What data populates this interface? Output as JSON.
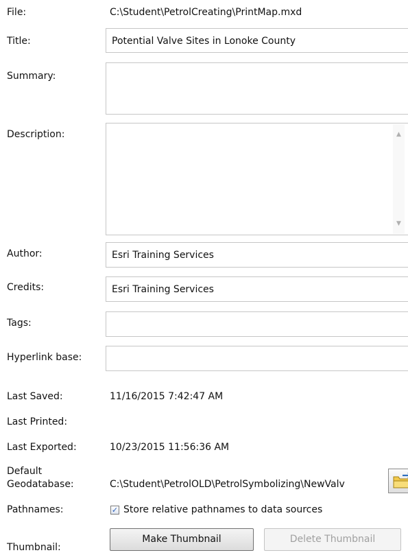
{
  "labels": {
    "file": "File:",
    "title": "Title:",
    "summary": "Summary:",
    "description": "Description:",
    "author": "Author:",
    "credits": "Credits:",
    "tags": "Tags:",
    "hyperlink_base": "Hyperlink base:",
    "last_saved": "Last Saved:",
    "last_printed": "Last Printed:",
    "last_exported": "Last Exported:",
    "default_geodatabase_line1": "Default",
    "default_geodatabase_line2": "Geodatabase:",
    "pathnames": "Pathnames:",
    "thumbnail": "Thumbnail:"
  },
  "values": {
    "file": "C:\\Student\\PetrolCreating\\PrintMap.mxd",
    "title": "Potential Valve Sites in Lonoke County",
    "summary": "",
    "description": "",
    "author": "Esri Training Services",
    "credits": "Esri Training Services",
    "tags": "",
    "hyperlink_base": "",
    "last_saved": "11/16/2015 7:42:47 AM",
    "last_printed": "",
    "last_exported": "10/23/2015 11:56:36 AM",
    "default_geodatabase": "C:\\Student\\PetrolOLD\\PetrolSymbolizing\\NewValv"
  },
  "pathnames": {
    "checkbox_label": "Store relative pathnames to data sources",
    "checked": true,
    "check_glyph": "✓"
  },
  "buttons": {
    "make_thumbnail": "Make Thumbnail",
    "delete_thumbnail": "Delete Thumbnail",
    "delete_thumbnail_enabled": false
  },
  "icons": {
    "browse": "folder-browse-icon",
    "scroll_up": "▲",
    "scroll_down": "▼"
  },
  "colors": {
    "field_border": "#c6c6c6",
    "checkbox_check": "#2b5fb8",
    "folder_yellow": "#f2c94c",
    "disabled_text": "#a0a0a0"
  }
}
